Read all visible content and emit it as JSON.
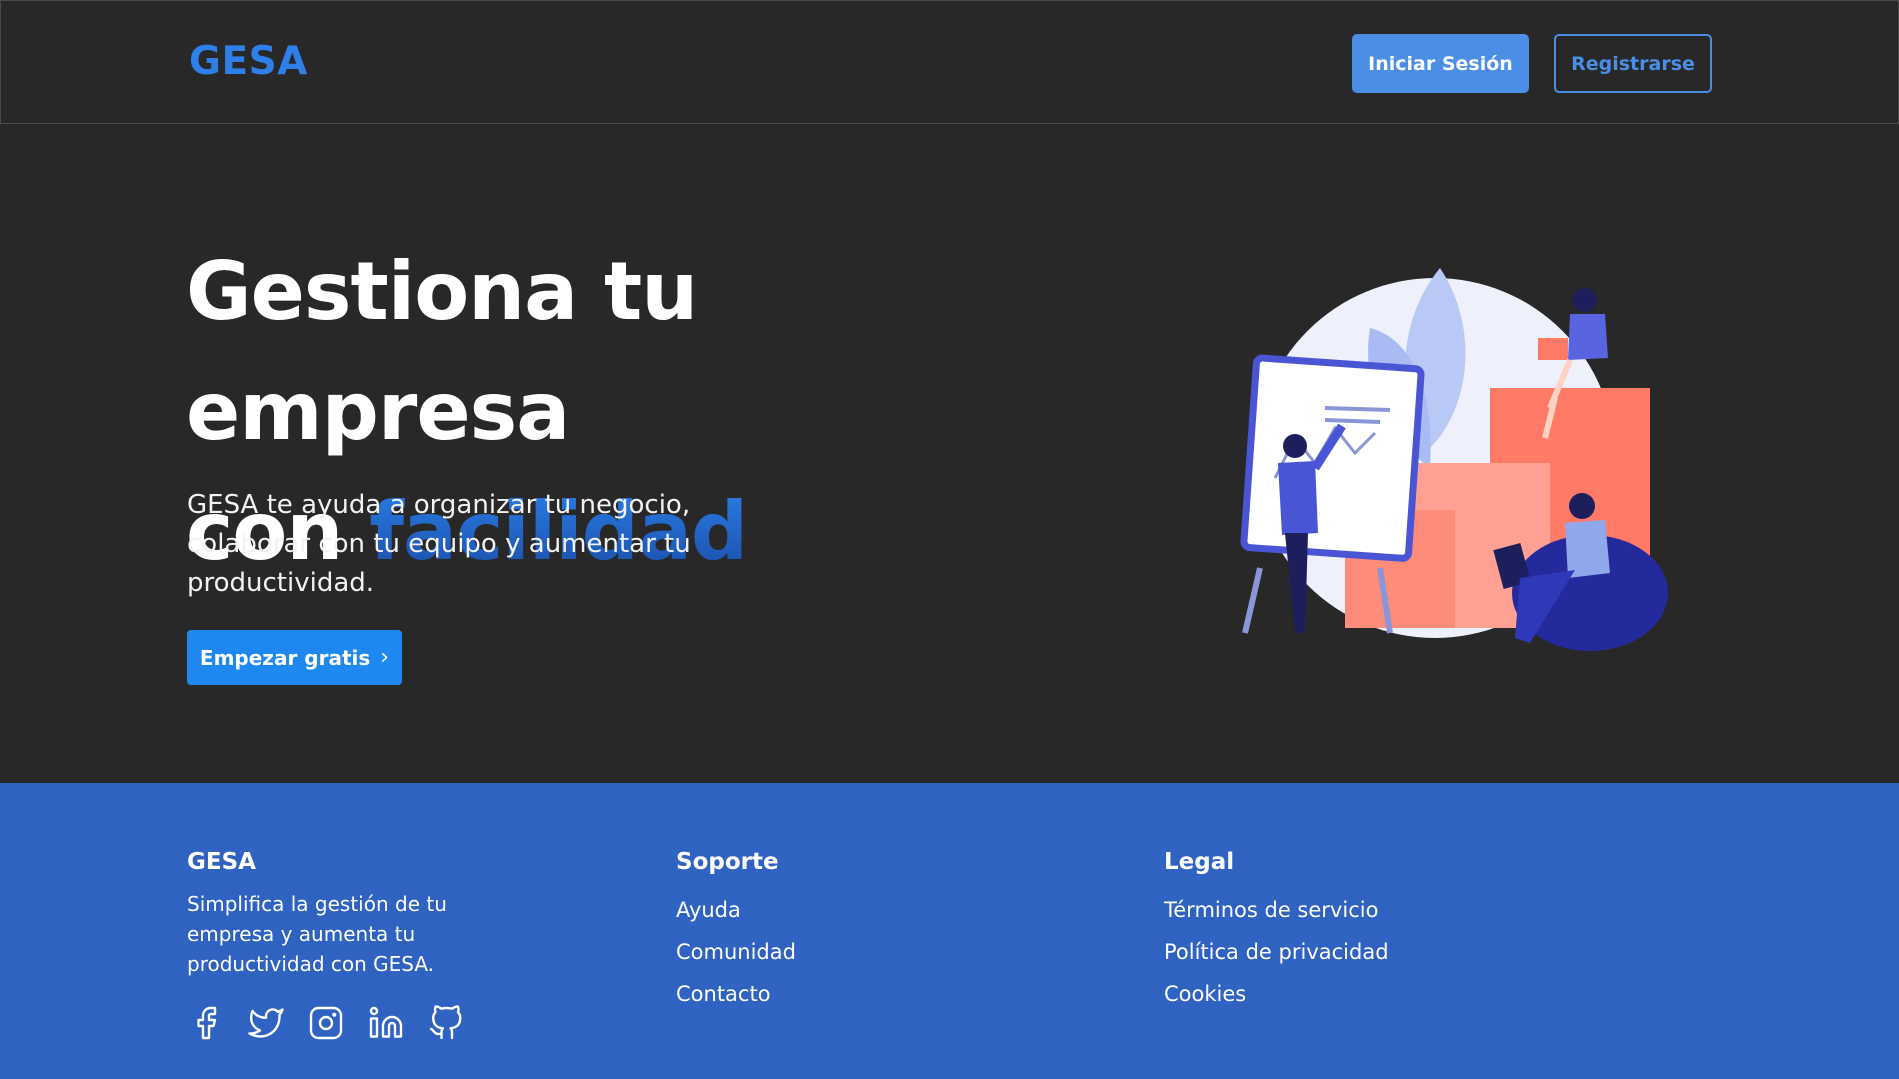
{
  "header": {
    "logo": "GESA",
    "login_label": "Iniciar Sesión",
    "register_label": "Registrarse"
  },
  "hero": {
    "title_line1": "Gestiona tu empresa",
    "title_line2_prefix": "con",
    "title_line2_accent": "facilidad",
    "description": "GESA te ayuda a organizar tu negocio, colaborar con tu equipo y aumentar tu productividad.",
    "cta_label": "Empezar gratis",
    "cta_icon": "chevron-right-icon"
  },
  "footer": {
    "brand": {
      "title": "GESA",
      "text": "Simplifica la gestión de tu empresa y aumenta tu productividad con GESA.",
      "social": [
        "facebook-icon",
        "twitter-icon",
        "instagram-icon",
        "linkedin-icon",
        "github-icon"
      ]
    },
    "support": {
      "title": "Soporte",
      "links": [
        "Ayuda",
        "Comunidad",
        "Contacto"
      ]
    },
    "legal": {
      "title": "Legal",
      "links": [
        "Términos de servicio",
        "Política de privacidad",
        "Cookies"
      ]
    }
  },
  "colors": {
    "background": "#282828",
    "brand_blue": "#2f7fe8",
    "footer_blue": "#3062c2",
    "cta_blue": "#1e88f0"
  }
}
